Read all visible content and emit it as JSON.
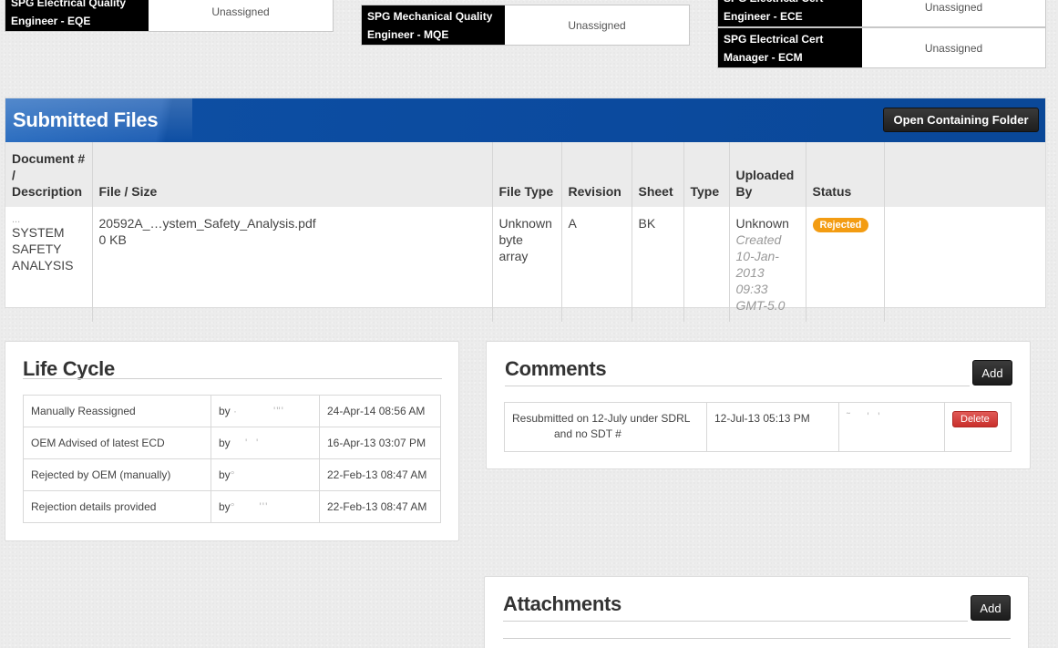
{
  "roles": [
    {
      "label": "SPG Electrical Quality Engineer - EQE",
      "value": "Unassigned"
    },
    {
      "label": "SPG Mechanical Quality Engineer - MQE",
      "value": "Unassigned"
    },
    {
      "label": "SPG Electrical Cert Engineer - ECE",
      "value": "Unassigned"
    },
    {
      "label": "SPG Electrical Cert Manager - ECM",
      "value": "Unassigned"
    }
  ],
  "submitted_files": {
    "title": "Submitted Files",
    "open_folder_label": "Open Containing Folder",
    "columns": [
      "Document # / Description",
      "File / Size",
      "File Type",
      "Revision",
      "Sheet",
      "Type",
      "Uploaded By",
      "Status"
    ],
    "rows": [
      {
        "doc_number": "...",
        "description": "SYSTEM SAFETY ANALYSIS",
        "file_name": "20592A_…ystem_Safety_Analysis.pdf",
        "file_size": "0 KB",
        "file_type": "Unknown byte array",
        "revision": "A",
        "sheet": "BK",
        "type": "",
        "uploaded_by": "Unknown",
        "created": "Created 10-Jan-2013 09:33 GMT-5.0",
        "status": "Rejected"
      }
    ]
  },
  "life_cycle": {
    "title": "Life Cycle",
    "rows": [
      {
        "event": "Manually Reassigned",
        "by": "by",
        "date": "24-Apr-14 08:56 AM"
      },
      {
        "event": "OEM Advised of latest ECD",
        "by": "by",
        "date": "16-Apr-13 03:07 PM"
      },
      {
        "event": "Rejected by OEM (manually)",
        "by": "by",
        "date": "22-Feb-13 08:47 AM"
      },
      {
        "event": "Rejection details provided",
        "by": "by",
        "date": "22-Feb-13 08:47 AM"
      }
    ]
  },
  "comments": {
    "title": "Comments",
    "add_label": "Add",
    "rows": [
      {
        "text_line1": "Resubmitted on 12-July under SDRL",
        "text_line2": "and no SDT #",
        "date": "12-Jul-13 05:13 PM",
        "author": "",
        "delete_label": "Delete"
      }
    ]
  },
  "attachments": {
    "title": "Attachments",
    "add_label": "Add"
  },
  "colors": {
    "header_blue": "#0b4a9e",
    "status_rejected": "#f39c12",
    "delete_red": "#c9302c"
  }
}
